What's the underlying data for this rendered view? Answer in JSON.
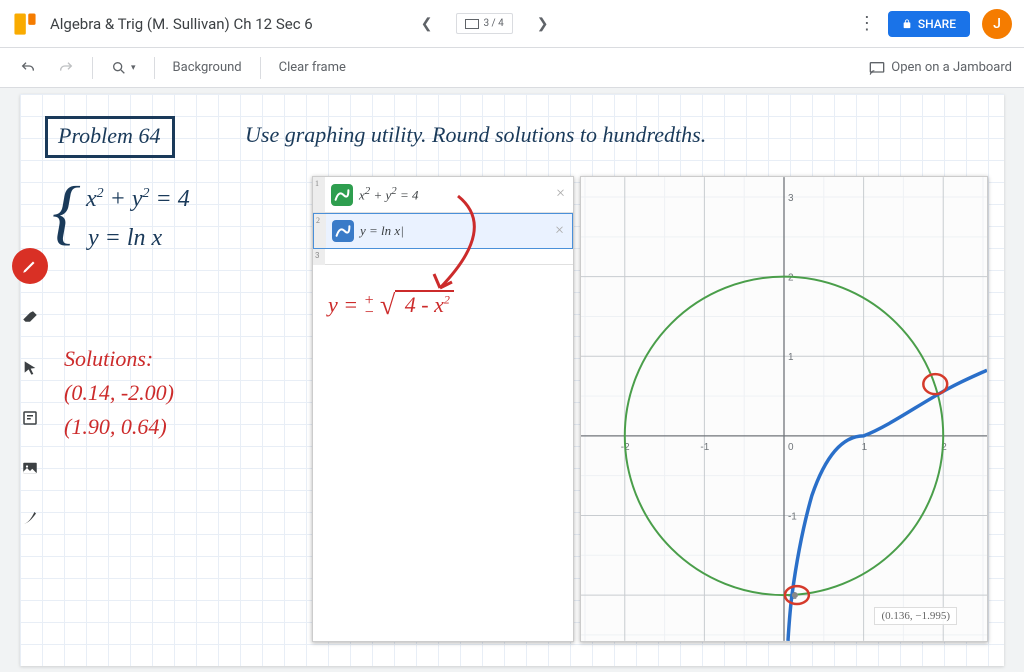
{
  "header": {
    "title": "Algebra & Trig (M. Sullivan) Ch 12 Sec 6",
    "frame_counter": "3 / 4",
    "share_label": "SHARE",
    "avatar_initial": "J"
  },
  "toolbar": {
    "background_label": "Background",
    "clear_label": "Clear frame",
    "open_label": "Open on a Jamboard"
  },
  "board": {
    "problem_label": "Problem  64",
    "instruction": "Use graphing utility. Round solutions to hundredths.",
    "system_eq1": "x² + y² = 4",
    "system_eq2": "y = ln x",
    "solutions_heading": "Solutions:",
    "solution1": "(0.14, -2.00)",
    "solution2": "(1.90, 0.64)",
    "red_annotation": "y = ± √(4 - x²)"
  },
  "calc": {
    "row1": "x² + y² = 4",
    "row2": "y = ln x"
  },
  "graph": {
    "coord_readout": "(0.136, −1.995)",
    "x_ticks": [
      "-2",
      "-1",
      "0",
      "1",
      "2"
    ],
    "y_ticks": [
      "-2",
      "-1",
      "1",
      "2",
      "3"
    ]
  },
  "chart_data": {
    "type": "line",
    "title": "",
    "xlabel": "",
    "ylabel": "",
    "xlim": [
      -2.5,
      2.6
    ],
    "ylim": [
      -2.6,
      3.4
    ],
    "series": [
      {
        "name": "x² + y² = 4 (circle)",
        "type": "implicit",
        "equation": "x^2 + y^2 = 4",
        "center": [
          0,
          0
        ],
        "radius": 2
      },
      {
        "name": "y = ln x",
        "type": "function",
        "equation": "ln(x)",
        "domain": [
          0.05,
          2.6
        ]
      }
    ],
    "intersections": [
      {
        "x": 0.14,
        "y": -2.0
      },
      {
        "x": 1.9,
        "y": 0.64
      }
    ],
    "readout_point": {
      "x": 0.136,
      "y": -1.995
    }
  }
}
